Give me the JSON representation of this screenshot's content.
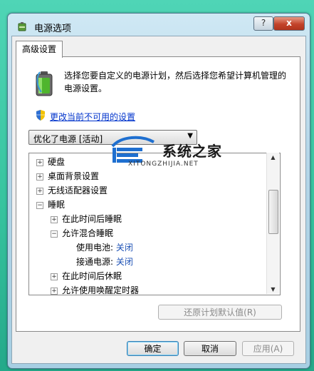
{
  "window": {
    "title": "电源选项",
    "help_label": "?",
    "close_label": "x"
  },
  "tabs": [
    {
      "label": "高级设置",
      "selected": true
    }
  ],
  "intro": {
    "text": "选择您要自定义的电源计划，然后选择您希望计算机管理的电源设置。"
  },
  "link": {
    "label": "更改当前不可用的设置"
  },
  "plan_select": {
    "value": "优化了电源 [活动]"
  },
  "tree": [
    {
      "expander": "+",
      "label": "硬盘",
      "value": ""
    },
    {
      "expander": "+",
      "label": "桌面背景设置",
      "value": ""
    },
    {
      "expander": "+",
      "label": "无线适配器设置",
      "value": ""
    },
    {
      "expander": "−",
      "label": "睡眠",
      "value": ""
    },
    {
      "expander": "+",
      "label": "在此时间后睡眠",
      "value": ""
    },
    {
      "expander": "−",
      "label": "允许混合睡眠",
      "value": ""
    },
    {
      "expander": "",
      "label": "使用电池:",
      "value": "关闭"
    },
    {
      "expander": "",
      "label": "接通电源:",
      "value": "关闭"
    },
    {
      "expander": "+",
      "label": "在此时间后休眠",
      "value": ""
    },
    {
      "expander": "+",
      "label": "允许使用唤醒定时器",
      "value": ""
    }
  ],
  "buttons": {
    "restore": "还原计划默认值(R)",
    "ok": "确定",
    "cancel": "取消",
    "apply": "应用(A)"
  },
  "watermark": {
    "text": "系统之家",
    "url": "XITONGZHIJIA.NET"
  },
  "colors": {
    "link": "#0033cc",
    "value_text": "#1a4fb4",
    "background": "#37c49f"
  }
}
